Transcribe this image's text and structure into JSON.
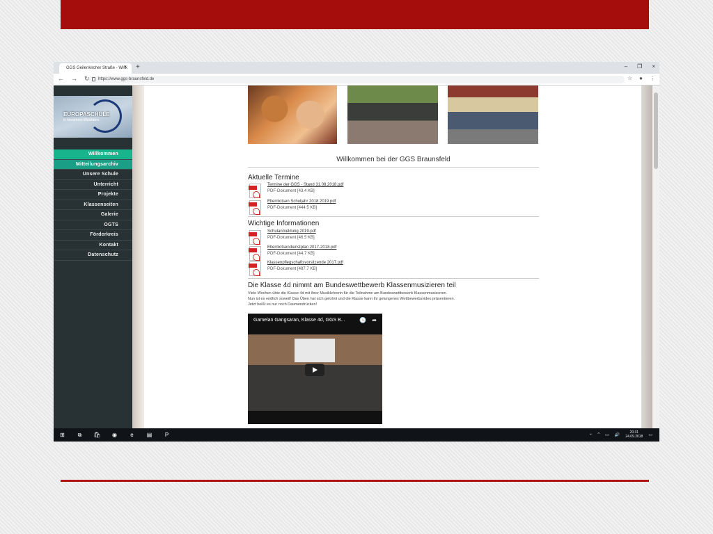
{
  "browser": {
    "tab_title": "GGS Geilenkircher Straße - Willk",
    "tab_close": "×",
    "new_tab": "+",
    "window_controls": [
      "–",
      "❐",
      "×"
    ],
    "url": "https://www.ggs-braunsfeld.de",
    "nav_icons": [
      "←",
      "→",
      "↻"
    ],
    "right_icons": [
      "☆",
      "●",
      "⋮"
    ]
  },
  "sidebar": {
    "logo_title": "EUROPASCHULE",
    "logo_sub": "in Nordrhein-Westfalen",
    "menu": [
      {
        "label": "Willkommen",
        "name": "sidebar-item-willkommen"
      },
      {
        "label": "Mitteilungsarchiv",
        "name": "sidebar-item-mitteilungsarchiv"
      },
      {
        "label": "Unsere Schule",
        "name": "sidebar-item-unsere-schule"
      },
      {
        "label": "Unterricht",
        "name": "sidebar-item-unterricht"
      },
      {
        "label": "Projekte",
        "name": "sidebar-item-projekte"
      },
      {
        "label": "Klassenseiten",
        "name": "sidebar-item-klassenseiten"
      },
      {
        "label": "Galerie",
        "name": "sidebar-item-galerie"
      },
      {
        "label": "OGTS",
        "name": "sidebar-item-ogts"
      },
      {
        "label": "Förderkreis",
        "name": "sidebar-item-foerderkreis"
      },
      {
        "label": "Kontakt",
        "name": "sidebar-item-kontakt"
      },
      {
        "label": "Datenschutz",
        "name": "sidebar-item-datenschutz"
      }
    ]
  },
  "main": {
    "welcome": "Willkommen bei der GGS Braunsfeld",
    "termine": {
      "title": "Aktuelle Termine",
      "docs": [
        {
          "link": "Termine der GGS - Stand 31.08.2018.pdf",
          "meta": "PDF-Dokument [43.4 KB]"
        },
        {
          "link": "Elternlotsen Schuljahr 2018 2019.pdf",
          "meta": "PDF-Dokument [444.5 KB]"
        }
      ]
    },
    "infos": {
      "title": "Wichtige Informationen",
      "docs": [
        {
          "link": "Schulanmeldung 2019.pdf",
          "meta": "PDF-Dokument [46.5 KB]"
        },
        {
          "link": "Elternlotsendienstplan 2017-2018.pdf",
          "meta": "PDF-Dokument [44.7 KB]"
        },
        {
          "link": "Klassenpflegschaftsvorsitzende 2017.pdf",
          "meta": "PDF-Dokument [487.7 KB]"
        }
      ]
    },
    "article": {
      "title": "Die Klasse 4d nimmt am Bundeswettbewerb Klassenmusizieren teil",
      "lines": [
        "Viele Wochen übte die Klasse 4d mit ihrer Musiklehrerin für die Teilnahme am Bundeswettbewerb Klassenmusizieren.",
        "Nun ist es endlich soweit! Das Üben hat sich gelohnt und die Klasse kann ihr gelungenes Wettbewerbsvideo präsentieren.",
        "Jetzt heißt es nur noch Daumendrücken!"
      ]
    },
    "video": {
      "title": "Gamelan Gangsaran, Klasse 4d, GGS B...",
      "icons": [
        "🕓",
        "➦"
      ]
    }
  },
  "taskbar": {
    "apps": [
      "⊞",
      "⧉",
      "🛍",
      "◉",
      "e",
      "▤",
      "P"
    ],
    "tray": [
      "⌐",
      "^",
      "▭",
      "🔊"
    ],
    "time": "20:31",
    "date": "24.09.2018",
    "notify": "▭"
  }
}
